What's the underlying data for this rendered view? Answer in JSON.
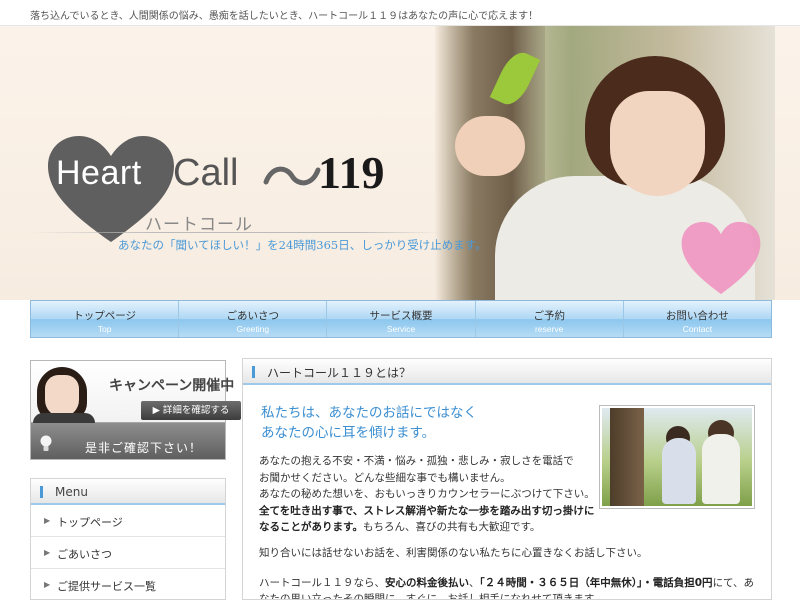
{
  "topbar": {
    "tagline": "落ち込んでいるとき、人間関係の悩み、愚痴を話したいとき、ハートコール１１９はあなたの声に心で応えます！"
  },
  "logo": {
    "heart_word": "Heart",
    "call_word": "Call",
    "number": "119",
    "kana": "ハートコール",
    "catch": "あなたの「聞いてほしい！」を24時間365日、しっかり受け止めます。"
  },
  "nav": {
    "items": [
      {
        "jp": "トップページ",
        "en": "Top"
      },
      {
        "jp": "ごあいさつ",
        "en": "Greeting"
      },
      {
        "jp": "サービス概要",
        "en": "Service"
      },
      {
        "jp": "ご予約",
        "en": "reserve"
      },
      {
        "jp": "お問い合わせ",
        "en": "Contact"
      }
    ]
  },
  "campaign": {
    "title": "キャンペーン開催中",
    "button": "▶ 詳細を確認する",
    "footer": "是非ご確認下さい！"
  },
  "menu": {
    "title": "Menu",
    "items": [
      {
        "label": "トップページ"
      },
      {
        "label": "ごあいさつ"
      },
      {
        "label": "ご提供サービス一覧"
      }
    ]
  },
  "main": {
    "heading": "ハートコール１１９とは？",
    "lead": [
      "私たちは、あなたのお話にではなく",
      "あなたの心に耳を傾けます。"
    ],
    "body": {
      "l1": "あなたの抱える不安・不満・悩み・孤独・悲しみ・寂しさを電話で",
      "l2": "お聞かせください。どんな些細な事でも構いません。",
      "l3": "あなたの秘めた想いを、おもいっきりカウンセラーにぶつけて下さい。",
      "l4_bold": "全てを吐き出す事で、ストレス解消や新たな一歩を踏み出す切っ掛けに",
      "l5_bold": "なることがあります。",
      "l5_rest": "もちろん、喜びの共有も大歓迎です。"
    },
    "p2": "知り合いには話せないお話を、利害関係のない私たちに心置きなくお話し下さい。",
    "p3": {
      "a": "ハートコール１１９なら、",
      "b_bold": "安心の料金後払い",
      "c": "、",
      "d_bold": "「２４時間・３６５日（年中無休）」・電話負担0円",
      "e": "にて、あ",
      "line2": "なたの思い立ったその瞬間に、すぐに、お話し相手になれせて頂きます。"
    }
  },
  "colors": {
    "accent_blue": "#4a9ad8",
    "nav_blue": "#aed7f4",
    "header_bg": "#fbf3ea",
    "heart_gray": "#5f5f5f",
    "heart_pink": "#f08fc0"
  },
  "icons": {
    "heart": "heart-icon",
    "bulb": "lightbulb-icon",
    "arrow": "arrow-right-icon"
  }
}
